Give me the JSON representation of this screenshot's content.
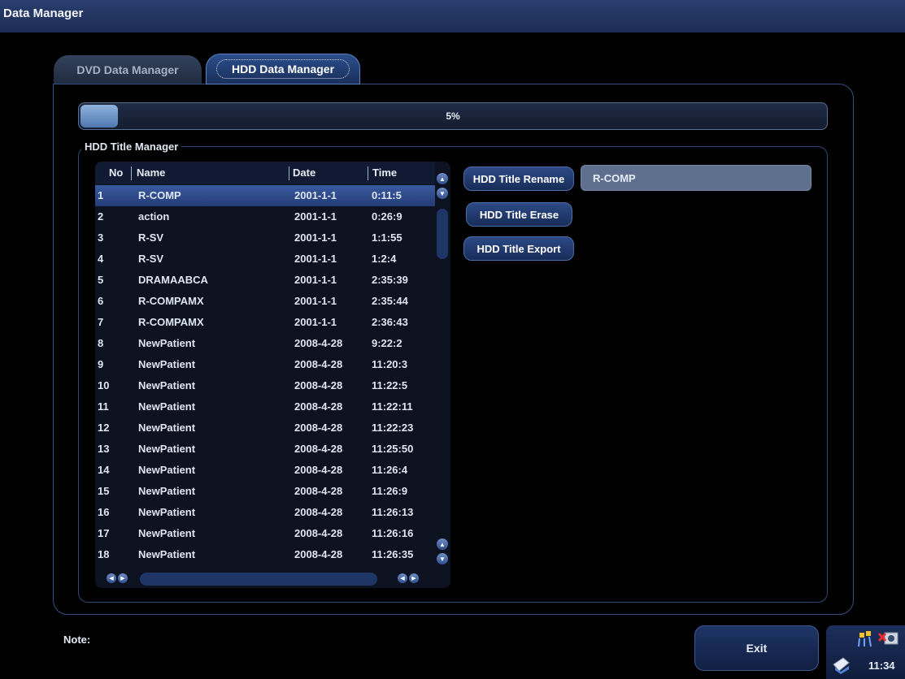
{
  "window": {
    "title": "Data Manager"
  },
  "tabs": [
    {
      "label": "DVD Data Manager"
    },
    {
      "label": "HDD Data Manager",
      "active": true
    }
  ],
  "progress": {
    "percent": 5,
    "label": "5%"
  },
  "group": {
    "title": "HDD Title Manager"
  },
  "table": {
    "headers": {
      "no": "No",
      "name": "Name",
      "date": "Date",
      "time": "Time"
    },
    "selected_index": 0,
    "rows": [
      {
        "no": "1",
        "name": "R-COMP",
        "date": "2001-1-1",
        "time": "0:11:5"
      },
      {
        "no": "2",
        "name": "action",
        "date": "2001-1-1",
        "time": "0:26:9"
      },
      {
        "no": "3",
        "name": "R-SV",
        "date": "2001-1-1",
        "time": "1:1:55"
      },
      {
        "no": "4",
        "name": "R-SV",
        "date": "2001-1-1",
        "time": "1:2:4"
      },
      {
        "no": "5",
        "name": "DRAMAABCA",
        "date": "2001-1-1",
        "time": "2:35:39"
      },
      {
        "no": "6",
        "name": "R-COMPAMX",
        "date": "2001-1-1",
        "time": "2:35:44"
      },
      {
        "no": "7",
        "name": "R-COMPAMX",
        "date": "2001-1-1",
        "time": "2:36:43"
      },
      {
        "no": "8",
        "name": "NewPatient",
        "date": "2008-4-28",
        "time": "9:22:2"
      },
      {
        "no": "9",
        "name": "NewPatient",
        "date": "2008-4-28",
        "time": "11:20:3"
      },
      {
        "no": "10",
        "name": "NewPatient",
        "date": "2008-4-28",
        "time": "11:22:5"
      },
      {
        "no": "11",
        "name": "NewPatient",
        "date": "2008-4-28",
        "time": "11:22:11"
      },
      {
        "no": "12",
        "name": "NewPatient",
        "date": "2008-4-28",
        "time": "11:22:23"
      },
      {
        "no": "13",
        "name": "NewPatient",
        "date": "2008-4-28",
        "time": "11:25:50"
      },
      {
        "no": "14",
        "name": "NewPatient",
        "date": "2008-4-28",
        "time": "11:26:4"
      },
      {
        "no": "15",
        "name": "NewPatient",
        "date": "2008-4-28",
        "time": "11:26:9"
      },
      {
        "no": "16",
        "name": "NewPatient",
        "date": "2008-4-28",
        "time": "11:26:13"
      },
      {
        "no": "17",
        "name": "NewPatient",
        "date": "2008-4-28",
        "time": "11:26:16"
      },
      {
        "no": "18",
        "name": "NewPatient",
        "date": "2008-4-28",
        "time": "11:26:35"
      }
    ]
  },
  "actions": {
    "rename_label": "HDD Title Rename",
    "erase_label": "HDD Title Erase",
    "export_label": "HDD Title Export",
    "rename_value": "R-COMP"
  },
  "footer": {
    "note_label": "Note:",
    "exit_label": "Exit"
  },
  "tray": {
    "time": "11:34",
    "icons": [
      "network-icon",
      "media-icon",
      "printer-icon"
    ]
  },
  "colors": {
    "accent": "#2b4e8c",
    "selected_row": "#3a5aa0",
    "background": "#000000"
  }
}
